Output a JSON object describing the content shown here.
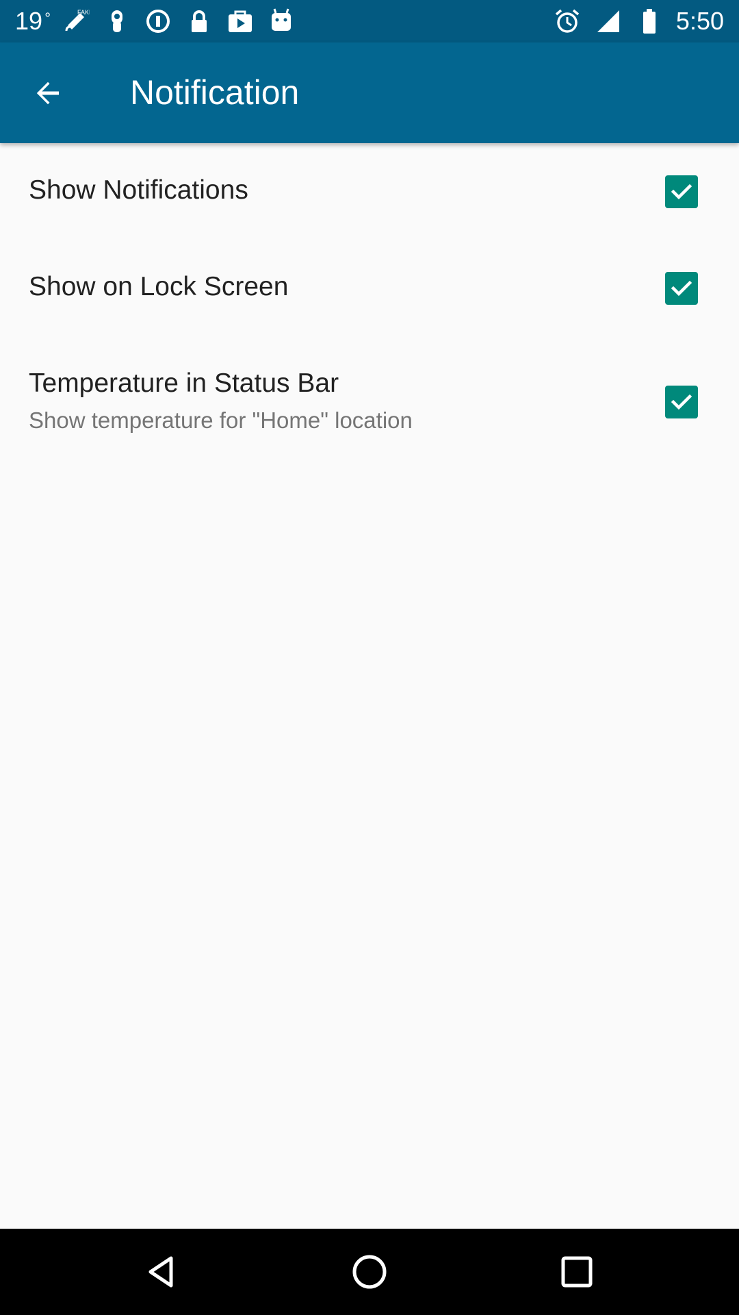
{
  "status_bar": {
    "temperature": "19",
    "degree_symbol": "°",
    "time": "5:50",
    "left_icons": [
      "fake-gps-icon",
      "touch-icon",
      "info-icon",
      "lock-icon",
      "play-store-icon",
      "android-icon"
    ],
    "right_icons": [
      "alarm-icon",
      "signal-icon",
      "battery-icon"
    ]
  },
  "app_bar": {
    "title": "Notification",
    "back_icon": "arrow-back-icon"
  },
  "preferences": [
    {
      "title": "Show Notifications",
      "summary": "",
      "checked": true
    },
    {
      "title": "Show on Lock Screen",
      "summary": "",
      "checked": true
    },
    {
      "title": "Temperature in Status Bar",
      "summary": "Show temperature for \"Home\" location",
      "checked": true
    }
  ],
  "nav_bar": {
    "buttons": [
      "back-triangle-icon",
      "home-circle-icon",
      "recents-square-icon"
    ]
  },
  "colors": {
    "status_bar": "#035a81",
    "app_bar": "#036690",
    "checkbox": "#00897b",
    "background": "#fafafa",
    "nav_bar": "#000000"
  }
}
